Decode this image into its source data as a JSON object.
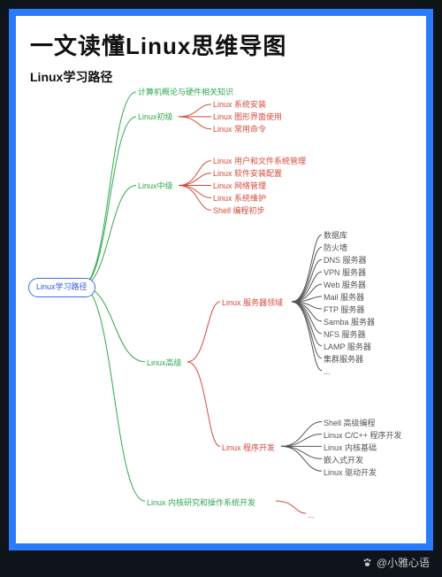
{
  "title": "一文读懂Linux思维导图",
  "subtitle": "Linux学习路径",
  "root": "Linux学习路径",
  "colors": {
    "green": "#2fa84f",
    "red": "#d64a3a",
    "gray": "#555555",
    "blue": "#2a5edb",
    "frame": "#2a7cff"
  },
  "branches": {
    "b0": {
      "label": "计算机概论与硬件相关知识"
    },
    "b1": {
      "label": "Linux初级",
      "children": [
        "Linux 系统安装",
        "Linux 图形界面使用",
        "Linux 常用命令"
      ]
    },
    "b2": {
      "label": "Linux中级",
      "children": [
        "Linux 用户和文件系统管理",
        "Linux 软件安装配置",
        "Linux 网络管理",
        "Linux 系统维护",
        "Shell 编程初步"
      ]
    },
    "b3": {
      "label": "Linux高级",
      "sub": {
        "s0": {
          "label": "Linux 服务器领域",
          "children": [
            "数据库",
            "防火墙",
            "DNS 服务器",
            "VPN 服务器",
            "Web 服务器",
            "Mail 服务器",
            "FTP 服务器",
            "Samba 服务器",
            "NFS 服务器",
            "LAMP 服务器",
            "集群服务器",
            "..."
          ]
        },
        "s1": {
          "label": "Linux 程序开发",
          "children": [
            "Shell 高级编程",
            "Linux C/C++ 程序开发",
            "Linux 内核基础",
            "嵌入式开发",
            "Linux 驱动开发"
          ]
        }
      }
    },
    "b4": {
      "label": "Linux 内核研究和操作系统开发",
      "children": [
        "..."
      ]
    }
  },
  "footer": "@小雅心语"
}
